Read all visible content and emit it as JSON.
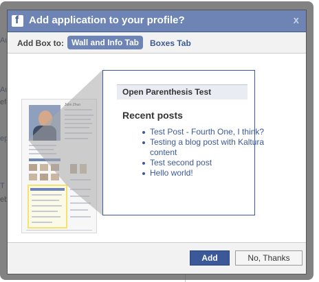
{
  "background": {
    "fragments": [
      "Au",
      "Au",
      "efa",
      "ep",
      "T",
      "eb",
      "ec"
    ]
  },
  "dialog": {
    "title": "Add application to your profile?",
    "close_glyph": "x",
    "logo_letter": "f",
    "add_box_label": "Add Box to:",
    "tabs": {
      "active": "Wall and Info Tab",
      "inactive": "Boxes Tab"
    },
    "preview": {
      "box_title": "Open Parenthesis Test",
      "heading": "Recent posts",
      "posts": [
        "Test Post - Fourth One, I think?",
        "Testing a blog post with Kaltura content",
        "Test second post",
        "Hello world!"
      ]
    },
    "thumbnail": {
      "name": "Julie Zhuo"
    },
    "buttons": {
      "add": "Add",
      "no_thanks": "No, Thanks"
    }
  },
  "colors": {
    "title_bar": "#6d84b4",
    "brand": "#3b5998",
    "highlight": "#f4e26b"
  }
}
